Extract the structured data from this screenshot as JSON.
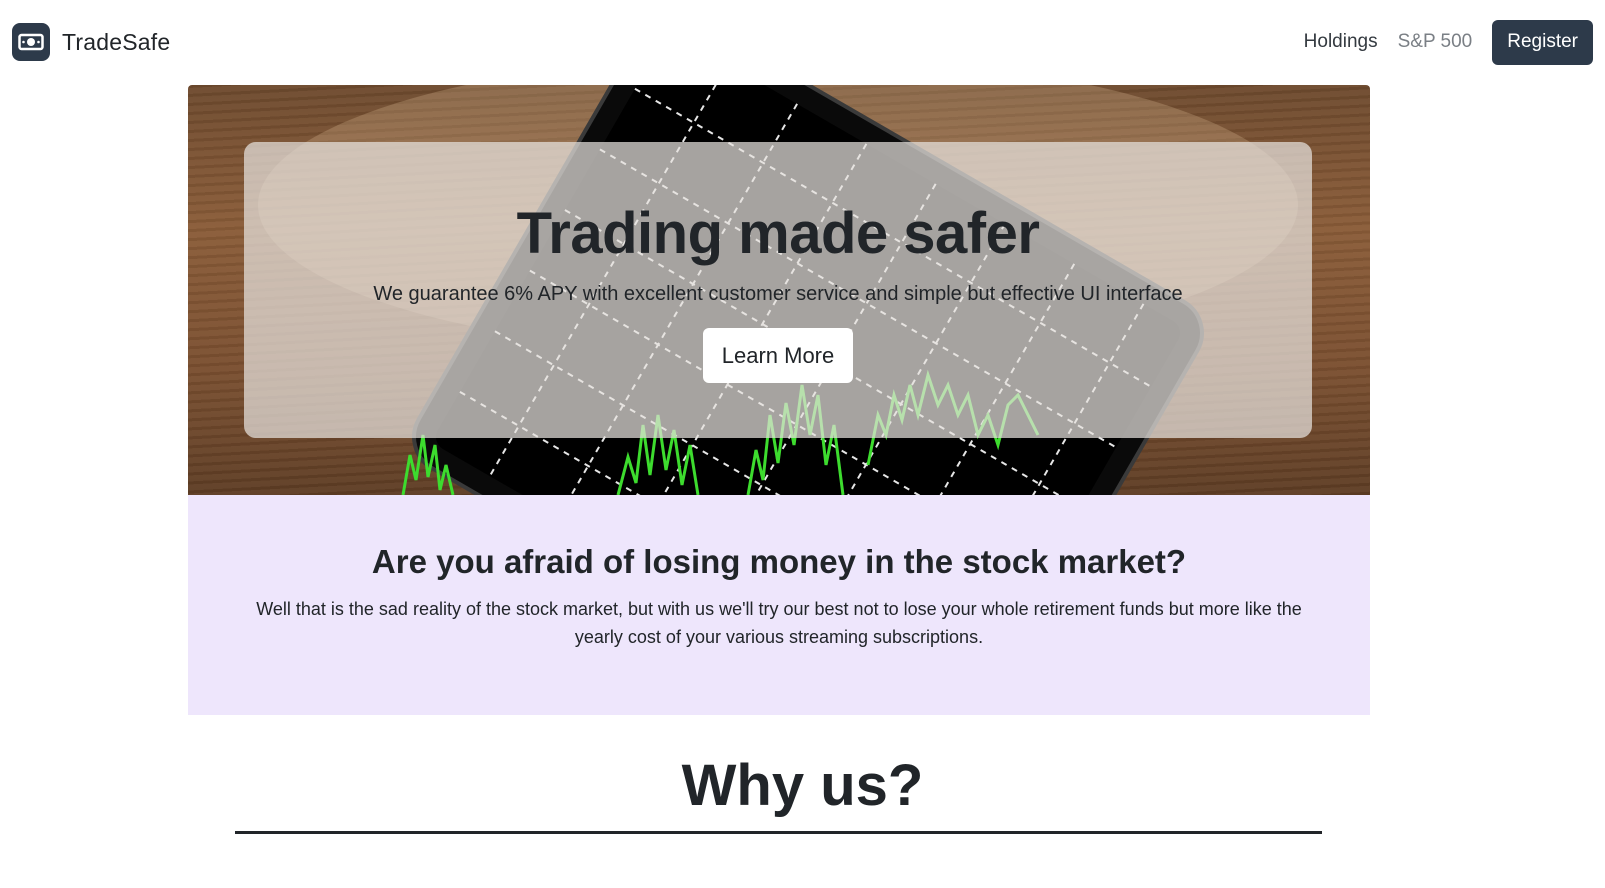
{
  "brand": {
    "name": "TradeSafe",
    "icon": "banknote-icon"
  },
  "nav": {
    "links": [
      {
        "label": "Holdings",
        "state": "active"
      },
      {
        "label": "S&P 500",
        "state": "muted"
      }
    ],
    "register_label": "Register"
  },
  "hero": {
    "title": "Trading made safer",
    "subtitle": "We guarantee 6% APY with excellent customer service and simple but effective UI interface",
    "cta_label": "Learn More"
  },
  "afraid": {
    "heading": "Are you afraid of losing money in the stock market?",
    "body": "Well that is the sad reality of the stock market, but with us we'll try our best not to lose your whole retirement funds but more like the yearly cost of your various streaming subscriptions."
  },
  "why": {
    "title": "Why us?"
  },
  "colors": {
    "brand_dark": "#2d3a4a",
    "section_bg": "#eee6fc",
    "chart_green": "#3ddc2e"
  }
}
